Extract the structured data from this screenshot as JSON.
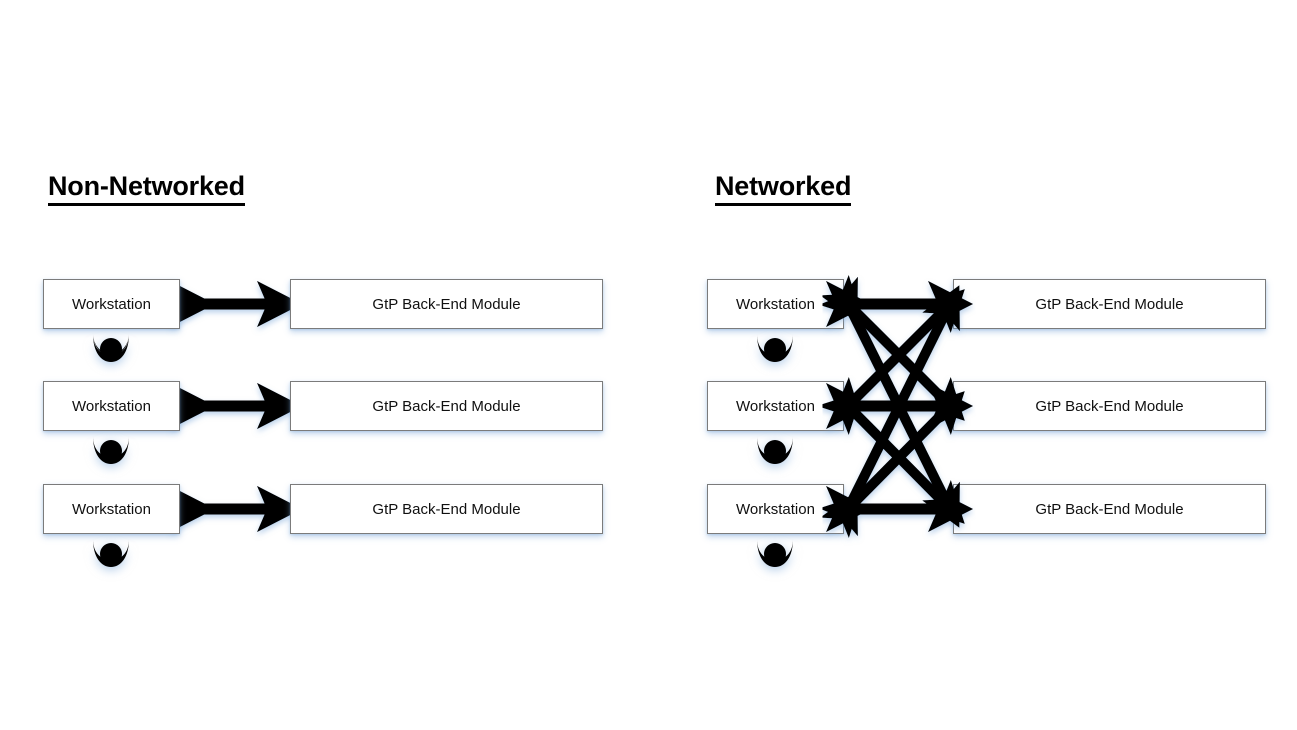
{
  "diagram": {
    "title_visible": false,
    "background_color": "#ffffff",
    "line_color": "#000000",
    "box_border_color": "#7b7b7b",
    "box_fill_color": "#ffffff",
    "shadow_color": "#78a5d7"
  },
  "sections": [
    {
      "id": "non-networked",
      "title": "Non-Networked",
      "connection_style": "one-to-one",
      "rows": [
        {
          "workstation_label": "Workstation",
          "module_label": "GtP Back-End Module",
          "user_icon": "person-icon",
          "connector": "double-headed-arrow"
        },
        {
          "workstation_label": "Workstation",
          "module_label": "GtP Back-End Module",
          "user_icon": "person-icon",
          "connector": "double-headed-arrow"
        },
        {
          "workstation_label": "Workstation",
          "module_label": "GtP Back-End Module",
          "user_icon": "person-icon",
          "connector": "double-headed-arrow"
        }
      ]
    },
    {
      "id": "networked",
      "title": "Networked",
      "connection_style": "full-mesh",
      "rows": [
        {
          "workstation_label": "Workstation",
          "module_label": "GtP Back-End Module",
          "user_icon": "person-icon",
          "connector": "double-headed-arrow"
        },
        {
          "workstation_label": "Workstation",
          "module_label": "GtP Back-End Module",
          "user_icon": "person-icon",
          "connector": "double-headed-arrow"
        },
        {
          "workstation_label": "Workstation",
          "module_label": "GtP Back-End Module",
          "user_icon": "person-icon",
          "connector": "double-headed-arrow"
        }
      ],
      "mesh_connection_count": 9
    }
  ]
}
